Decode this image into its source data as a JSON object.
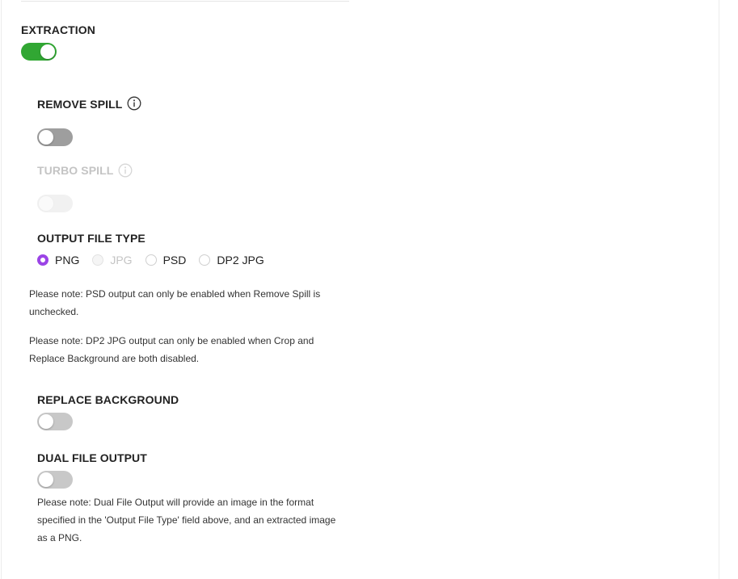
{
  "extraction": {
    "heading": "EXTRACTION",
    "enabled": true
  },
  "remove_spill": {
    "heading": "REMOVE SPILL",
    "enabled": false,
    "info_icon": "info-icon"
  },
  "turbo_spill": {
    "heading": "TURBO SPILL",
    "enabled": false,
    "disabled": true,
    "info_icon": "info-icon"
  },
  "output_file_type": {
    "heading": "OUTPUT FILE TYPE",
    "options": [
      {
        "label": "PNG",
        "selected": true,
        "disabled": false
      },
      {
        "label": "JPG",
        "selected": false,
        "disabled": true
      },
      {
        "label": "PSD",
        "selected": false,
        "disabled": false
      },
      {
        "label": "DP2 JPG",
        "selected": false,
        "disabled": false
      }
    ],
    "note_psd_line1": "Please note: PSD output can only be enabled when Remove Spill is",
    "note_psd_line2": "unchecked.",
    "note_dp2_line1": "Please note: DP2 JPG output can only be enabled when Crop and",
    "note_dp2_line2": "Replace Background are both disabled."
  },
  "replace_background": {
    "heading": "REPLACE BACKGROUND",
    "enabled": false
  },
  "dual_file_output": {
    "heading": "DUAL FILE OUTPUT",
    "enabled": false,
    "note_line1": "Please note: Dual File Output will provide an image in the format",
    "note_line2": "specified in the 'Output File Type' field above, and an extracted image",
    "note_line3": "as a PNG."
  },
  "colors": {
    "toggle_on": "#31a733",
    "toggle_off": "#9e9e9e",
    "radio_selected": "#9b44e6",
    "disabled_text": "#c4c4c4"
  }
}
